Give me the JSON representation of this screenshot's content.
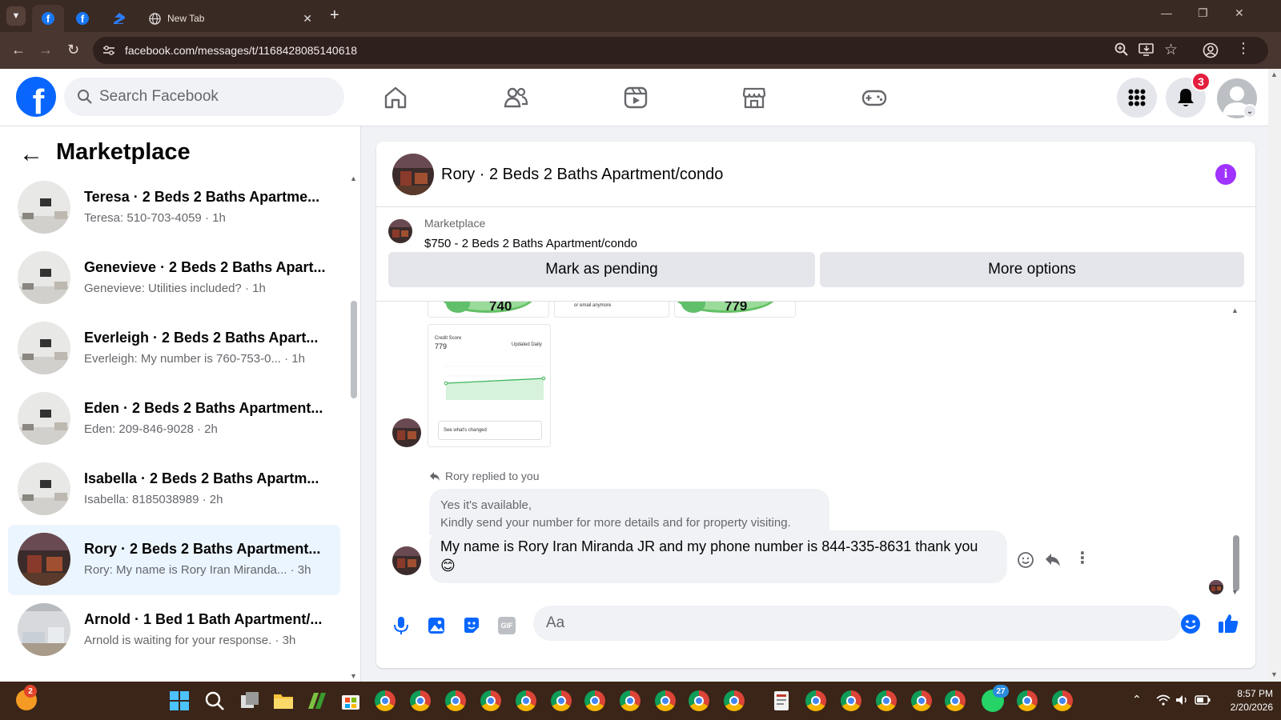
{
  "browser": {
    "tabs": [
      {
        "title": ""
      },
      {
        "title": ""
      },
      {
        "title": ""
      },
      {
        "title": "New Tab"
      }
    ],
    "new_tab": "+",
    "url": "facebook.com/messages/t/1168428085140618"
  },
  "fb_nav": {
    "logo_letter": "f",
    "search_placeholder": "Search Facebook",
    "notifications_count": "3"
  },
  "sidebar": {
    "title": "Marketplace",
    "conversations": [
      {
        "name": "Teresa · 2 Beds 2 Baths Apartme...",
        "preview": "Teresa: 510-703-4059 · 1h"
      },
      {
        "name": "Genevieve · 2 Beds 2 Baths Apart...",
        "preview": "Genevieve: Utilities included? · 1h"
      },
      {
        "name": "Everleigh · 2 Beds 2 Baths Apart...",
        "preview": "Everleigh: My number is 760-753-0...  · 1h"
      },
      {
        "name": "Eden · 2 Beds 2 Baths Apartment...",
        "preview": "Eden: 209-846-9028 · 2h"
      },
      {
        "name": "Isabella · 2 Beds 2 Baths Apartm...",
        "preview": "Isabella: 8185038989 · 2h"
      },
      {
        "name": "Rory · 2 Beds 2 Baths Apartment...",
        "preview": "Rory: My name is Rory Iran Miranda... · 3h"
      },
      {
        "name": "Arnold · 1 Bed 1 Bath Apartment/...",
        "preview": "Arnold is waiting for your response. · 3h"
      }
    ]
  },
  "chat": {
    "title": "Rory · 2 Beds 2 Baths Apartment/condo",
    "listing_source": "Marketplace",
    "listing_title": "$750 - 2 Beds 2 Baths Apartment/condo",
    "mark_pending": "Mark as pending",
    "more_options": "More options",
    "image_scores": [
      "740",
      "779",
      "779"
    ],
    "image_labels": {
      "credit_score": "Credit Score",
      "updated": "Updated Daily",
      "see_changed": "See what's changed",
      "email": "or email anymore"
    },
    "reply_meta": "Rory replied to you",
    "reply_line1": "Yes it's available,",
    "reply_line2": "Kindly send your number for more details and for property visiting.",
    "message_text": "My name is Rory Iran Miranda JR and my phone number is 844-335-8631 thank you",
    "message_emoji": "😊",
    "composer_placeholder": "Aa",
    "gif_label": "GIF"
  },
  "taskbar": {
    "time": "8:57 PM",
    "date": "2/20/2026",
    "badge_left": "2",
    "badge_whatsapp": "27"
  },
  "colors": {
    "fb_blue": "#0866ff",
    "messenger_purple": "#a033ff",
    "active_conv": "#ebf5ff",
    "notif_red": "#e41e3f"
  }
}
